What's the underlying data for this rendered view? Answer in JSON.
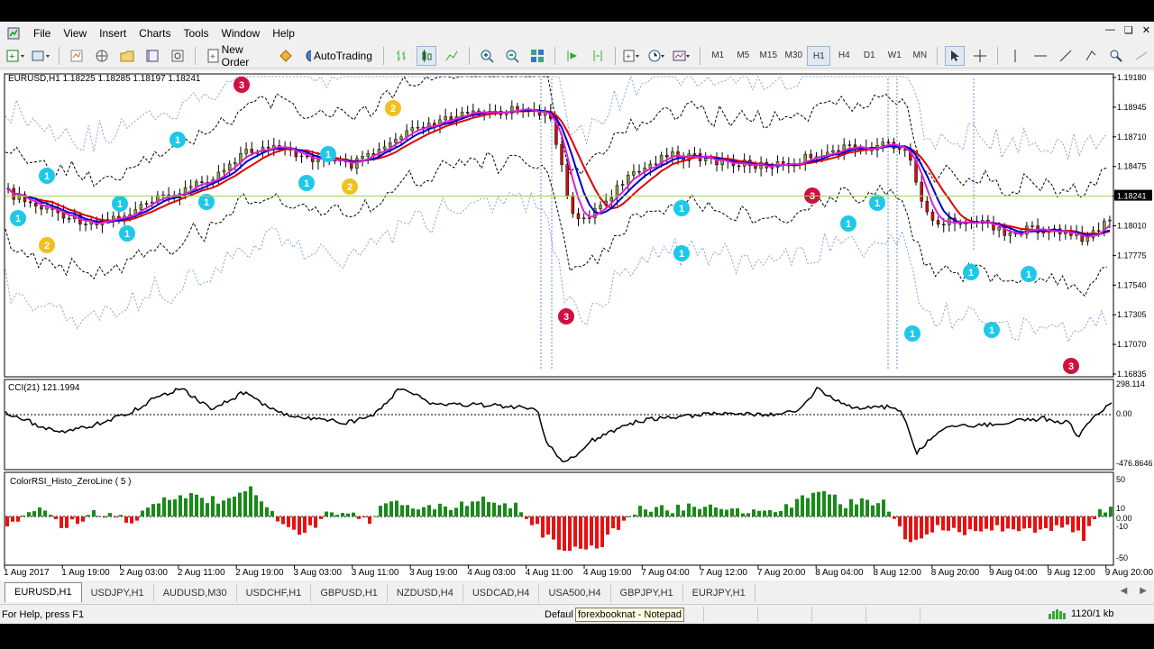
{
  "menu": {
    "items": [
      "File",
      "View",
      "Insert",
      "Charts",
      "Tools",
      "Window",
      "Help"
    ]
  },
  "toolbar": {
    "new_order_label": "New Order",
    "autotrading_label": "AutoTrading",
    "timeframes": [
      "M1",
      "M5",
      "M15",
      "M30",
      "H1",
      "H4",
      "D1",
      "W1",
      "MN"
    ],
    "active_timeframe": "H1"
  },
  "chart": {
    "header": "EURUSD,H1  1.18225  1.18285  1.18197  1.18241",
    "current_price_label": "1.18241",
    "price_axis": [
      "1.19180",
      "1.18945",
      "1.18710",
      "1.18475",
      "1.18241",
      "1.18010",
      "1.17775",
      "1.17540",
      "1.17305",
      "1.17070",
      "1.16835"
    ],
    "cci_title": "CCI(21) 121.1994",
    "cci_axis": [
      "298.114",
      "0.00",
      "-476.8646"
    ],
    "rsi_title": "ColorRSI_Histo_ZeroLine ( 5 )",
    "rsi_axis": [
      "50",
      "10",
      "0.00",
      "-10",
      "-50"
    ],
    "time_axis": [
      "1 Aug 2017",
      "1 Aug 19:00",
      "2 Aug 03:00",
      "2 Aug 11:00",
      "2 Aug 19:00",
      "3 Aug 03:00",
      "3 Aug 11:00",
      "3 Aug 19:00",
      "4 Aug 03:00",
      "4 Aug 11:00",
      "4 Aug 19:00",
      "7 Aug 04:00",
      "7 Aug 12:00",
      "7 Aug 20:00",
      "8 Aug 04:00",
      "8 Aug 12:00",
      "8 Aug 20:00",
      "9 Aug 04:00",
      "9 Aug 12:00",
      "9 Aug 20:00"
    ],
    "colors": {
      "ma_red": "#e00000",
      "ma_blue": "#0000cc",
      "ma_magenta": "#e020d0",
      "bull": "#7fa032",
      "bear": "#cc1010",
      "price_line": "#9bd84c",
      "marker_cyan": "#1ec8e8",
      "marker_yellow": "#f0c020",
      "marker_red": "#d01040"
    },
    "markers": [
      {
        "label": "1",
        "kind": "cyan"
      },
      {
        "label": "1",
        "kind": "cyan"
      },
      {
        "label": "2",
        "kind": "yellow"
      },
      {
        "label": "1",
        "kind": "cyan"
      },
      {
        "label": "1",
        "kind": "cyan"
      },
      {
        "label": "1",
        "kind": "cyan"
      },
      {
        "label": "1",
        "kind": "cyan"
      },
      {
        "label": "3",
        "kind": "red"
      },
      {
        "label": "1",
        "kind": "cyan"
      },
      {
        "label": "1",
        "kind": "cyan"
      },
      {
        "label": "2",
        "kind": "yellow"
      },
      {
        "label": "2",
        "kind": "yellow"
      },
      {
        "label": "3",
        "kind": "red"
      },
      {
        "label": "1",
        "kind": "cyan"
      },
      {
        "label": "1",
        "kind": "cyan"
      },
      {
        "label": "3",
        "kind": "red"
      },
      {
        "label": "1",
        "kind": "cyan"
      },
      {
        "label": "1",
        "kind": "cyan"
      },
      {
        "label": "1",
        "kind": "cyan"
      },
      {
        "label": "1",
        "kind": "cyan"
      },
      {
        "label": "1",
        "kind": "cyan"
      },
      {
        "label": "1",
        "kind": "cyan"
      },
      {
        "label": "3",
        "kind": "red"
      }
    ]
  },
  "tabs": [
    "EURUSD,H1",
    "USDJPY,H1",
    "AUDUSD,M30",
    "USDCHF,H1",
    "GBPUSD,H1",
    "NZDUSD,H4",
    "USDCAD,H4",
    "USA500,H4",
    "GBPJPY,H1",
    "EURJPY,H1"
  ],
  "active_tab": "EURUSD,H1",
  "status": {
    "help": "For Help, press F1",
    "profile": "Defaul",
    "tooltip": "forexbooknat - Notepad",
    "traffic": "1120/1 kb"
  }
}
